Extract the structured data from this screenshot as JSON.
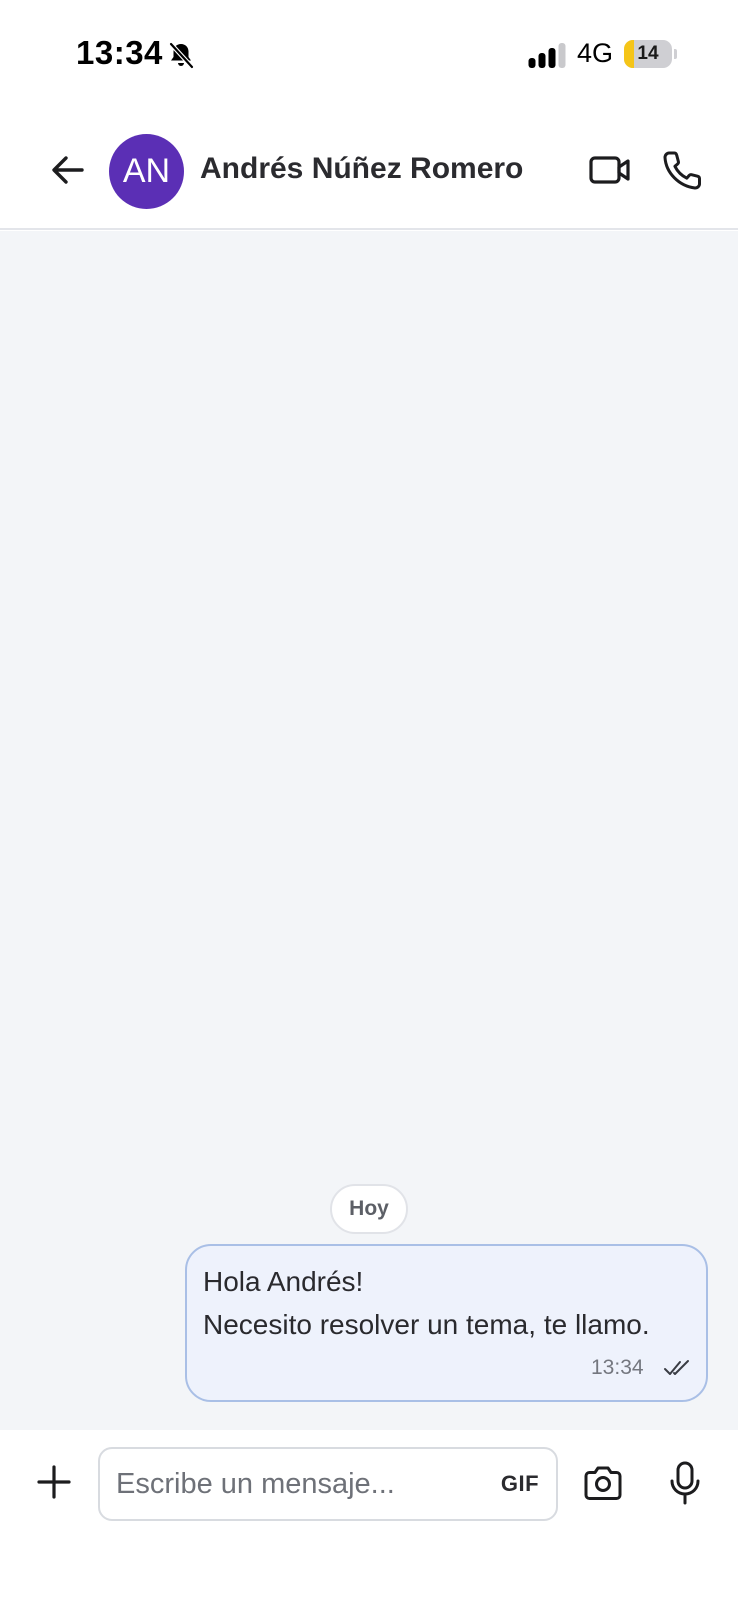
{
  "status_bar": {
    "time": "13:34",
    "network": "4G",
    "battery_level": "14",
    "battery_fraction": 0.14,
    "icons": [
      "bell-slash-icon",
      "signal-icon",
      "battery-icon"
    ]
  },
  "header": {
    "avatar_initials": "AN",
    "avatar_color": "#5b2fb5",
    "contact_name": "Andrés Núñez Romero",
    "icons": [
      "arrow-left-icon",
      "video-camera-icon",
      "phone-icon"
    ]
  },
  "chat": {
    "date_label": "Hoy",
    "messages": [
      {
        "direction": "outgoing",
        "lines": [
          "Hola Andrés!",
          "Necesito resolver un tema, te llamo."
        ],
        "time": "13:34",
        "status": "read"
      }
    ]
  },
  "composer": {
    "placeholder": "Escribe un mensaje...",
    "value": "",
    "gif_label": "GIF",
    "icons": [
      "plus-icon",
      "camera-icon",
      "microphone-icon"
    ]
  },
  "colors": {
    "accent": "#5b2fb5",
    "chat_background": "#f3f5f8",
    "bubble_background": "#eef2fc",
    "bubble_border": "#a9bfe6"
  }
}
